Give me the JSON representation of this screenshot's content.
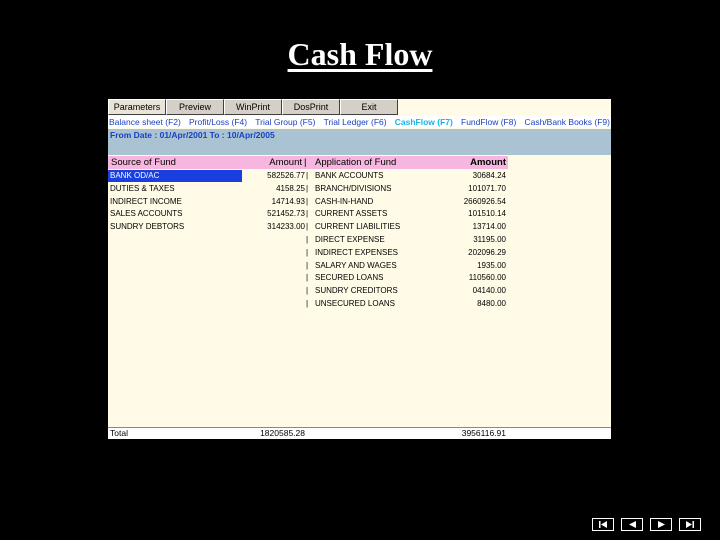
{
  "slide": {
    "title": "Cash Flow"
  },
  "toolbar": {
    "buttons": [
      {
        "label": "Parameters"
      },
      {
        "label": "Preview"
      },
      {
        "label": "WinPrint"
      },
      {
        "label": "DosPrint"
      },
      {
        "label": "Exit"
      }
    ]
  },
  "tabs": [
    {
      "label": "Balance sheet (F2)"
    },
    {
      "label": "Profit/Loss (F4)"
    },
    {
      "label": "Trial Group (F5)"
    },
    {
      "label": "Trial Ledger (F6)"
    },
    {
      "label": "CashFlow (F7)",
      "active": true
    },
    {
      "label": "FundFlow (F8)"
    },
    {
      "label": "Cash/Bank Books (F9)"
    }
  ],
  "date_range": "From Date : 01/Apr/2001 To : 10/Apr/2005",
  "table": {
    "headers": {
      "source": "Source of Fund",
      "amount": "Amount",
      "application": "Application of Fund",
      "amount2": "Amount"
    },
    "rows": [
      {
        "source": "BANK OD/AC",
        "amount": "582526.77",
        "sep": "|",
        "application": "BANK ACCOUNTS",
        "amount2": "30684.24"
      },
      {
        "source": "DUTIES & TAXES",
        "amount": "4158.25",
        "sep": "|",
        "application": "BRANCH/DIVISIONS",
        "amount2": "101071.70"
      },
      {
        "source": "INDIRECT INCOME",
        "amount": "14714.93",
        "sep": "|",
        "application": "CASH-IN-HAND",
        "amount2": "2660926.54"
      },
      {
        "source": "SALES ACCOUNTS",
        "amount": "521452.73",
        "sep": "|",
        "application": "CURRENT ASSETS",
        "amount2": "101510.14"
      },
      {
        "source": "SUNDRY DEBTORS",
        "amount": "314233.00",
        "sep": "|",
        "application": "CURRENT LIABILITIES",
        "amount2": "13714.00"
      },
      {
        "source": "",
        "amount": "",
        "sep": "|",
        "application": "DIRECT EXPENSE",
        "amount2": "31195.00"
      },
      {
        "source": "",
        "amount": "",
        "sep": "|",
        "application": "INDIRECT EXPENSES",
        "amount2": "202096.29"
      },
      {
        "source": "",
        "amount": "",
        "sep": "|",
        "application": "SALARY AND WAGES",
        "amount2": "1935.00"
      },
      {
        "source": "",
        "amount": "",
        "sep": "|",
        "application": "SECURED LOANS",
        "amount2": "110560.00"
      },
      {
        "source": "",
        "amount": "",
        "sep": "|",
        "application": "SUNDRY CREDITORS",
        "amount2": "04140.00"
      },
      {
        "source": "",
        "amount": "",
        "sep": "|",
        "application": "UNSECURED LOANS",
        "amount2": "8480.00"
      }
    ],
    "total": {
      "label": "Total",
      "amount": "1820585.28",
      "amount2": "3956116.91"
    }
  },
  "colors": {
    "header_bg": "#f7b6df",
    "selection": "#1a3fe0",
    "tab_text": "#1a3fc0",
    "active_tab": "#18b5e8",
    "datebar": "#a9c3d2"
  },
  "nav_icons": [
    "first-slide-icon",
    "previous-slide-icon",
    "next-slide-icon",
    "last-slide-icon"
  ]
}
